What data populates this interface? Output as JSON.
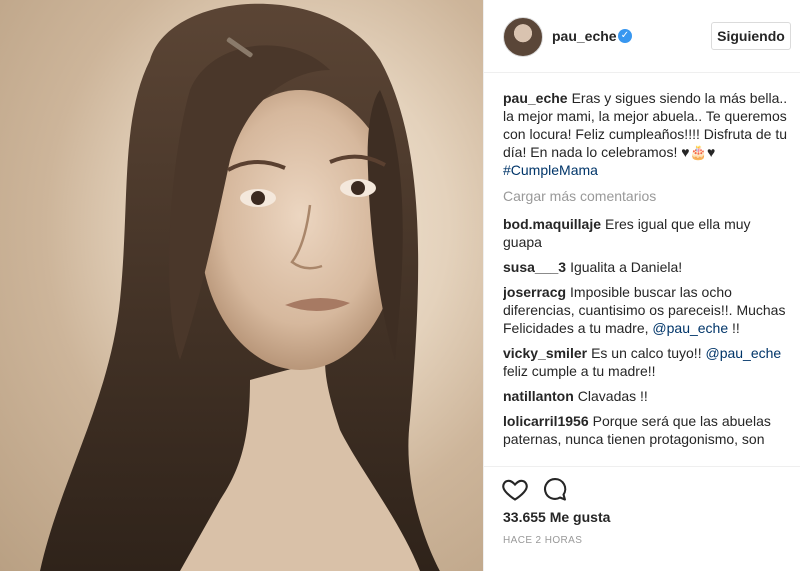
{
  "post": {
    "image_alt": "Vintage sepia portrait of a young woman with long hair"
  },
  "header": {
    "username": "pau_eche",
    "verified_glyph": "✓",
    "follow_label": "Siguiendo"
  },
  "caption": {
    "username": "pau_eche",
    "text": "Eras y sigues siendo la más bella.. la mejor mami, la mejor abuela.. Te queremos con locura! Feliz cumpleaños!!!! Disfruta de tu día! En nada lo celebramos! ",
    "emoji": "♥🎂♥ ",
    "hashtag": "#CumpleMama"
  },
  "load_more_label": "Cargar más comentarios",
  "comments": [
    {
      "username": "bod.maquillaje",
      "text": "Eres igual que ella muy guapa"
    },
    {
      "username": "susa___3",
      "text": "Igualita a Daniela!"
    },
    {
      "username": "joserracg",
      "text": "Imposible buscar las ocho diferencias, cuantisimo os pareceis!!. Muchas Felicidades a tu madre, ",
      "mention": "@pau_eche",
      "text_after": " !!"
    },
    {
      "username": "vicky_smiler",
      "text": "Es un calco tuyo!! ",
      "mention": "@pau_eche",
      "text_after": " feliz cumple a tu madre!!"
    },
    {
      "username": "natillanton",
      "text": "Clavadas !!"
    },
    {
      "username": "lolicarril1956",
      "text": "Porque será que las abuelas paternas, nunca tienen protagonismo, son"
    }
  ],
  "actions": {
    "like_icon": "heart-icon",
    "comment_icon": "speech-bubble-icon",
    "likes_text": "33.655 Me gusta",
    "time_text": "HACE 2 HORAS"
  }
}
